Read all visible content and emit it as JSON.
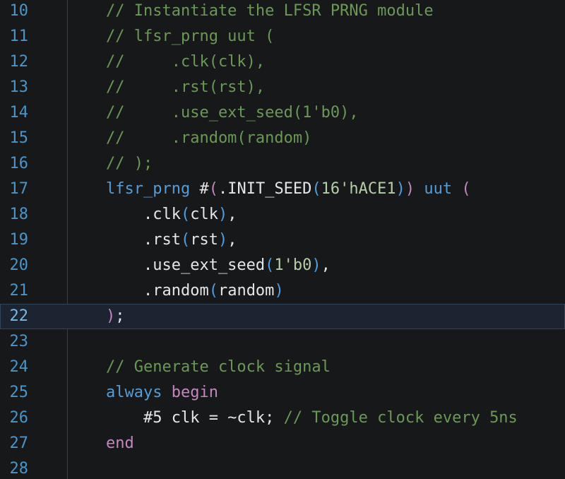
{
  "editor": {
    "colors": {
      "background": "#17181a",
      "line_number": "#4b95c8",
      "comment": "#6a9955",
      "keyword": "#569cd6",
      "control": "#c586c0",
      "number": "#b5cea8",
      "current_line": "#1b2430"
    },
    "current_line_number": "22",
    "lines": [
      {
        "num": "10",
        "tokens": [
          {
            "t": "// Instantiate the LFSR PRNG module",
            "c": "comment"
          }
        ]
      },
      {
        "num": "11",
        "tokens": [
          {
            "t": "// lfsr_prng uut (",
            "c": "comment"
          }
        ]
      },
      {
        "num": "12",
        "tokens": [
          {
            "t": "//     .clk(clk),",
            "c": "comment"
          }
        ]
      },
      {
        "num": "13",
        "tokens": [
          {
            "t": "//     .rst(rst),",
            "c": "comment"
          }
        ]
      },
      {
        "num": "14",
        "tokens": [
          {
            "t": "//     .use_ext_seed(1'b0),",
            "c": "comment"
          }
        ]
      },
      {
        "num": "15",
        "tokens": [
          {
            "t": "//     .random(random)",
            "c": "comment"
          }
        ]
      },
      {
        "num": "16",
        "tokens": [
          {
            "t": "// );",
            "c": "comment"
          }
        ]
      },
      {
        "num": "17",
        "tokens": [
          {
            "t": "lfsr_prng",
            "c": "keyword"
          },
          {
            "t": " #",
            "c": "ident"
          },
          {
            "t": "(",
            "c": "paren1"
          },
          {
            "t": ".INIT_SEED",
            "c": "ident"
          },
          {
            "t": "(",
            "c": "paren2"
          },
          {
            "t": "16'hACE1",
            "c": "number"
          },
          {
            "t": ")",
            "c": "paren2"
          },
          {
            "t": ")",
            "c": "paren1"
          },
          {
            "t": " ",
            "c": "ident"
          },
          {
            "t": "uut",
            "c": "keyword"
          },
          {
            "t": " ",
            "c": "ident"
          },
          {
            "t": "(",
            "c": "paren1"
          }
        ]
      },
      {
        "num": "18",
        "tokens": [
          {
            "t": "    .clk",
            "c": "ident"
          },
          {
            "t": "(",
            "c": "paren2"
          },
          {
            "t": "clk",
            "c": "ident"
          },
          {
            "t": ")",
            "c": "paren2"
          },
          {
            "t": ",",
            "c": "ident"
          }
        ]
      },
      {
        "num": "19",
        "tokens": [
          {
            "t": "    .rst",
            "c": "ident"
          },
          {
            "t": "(",
            "c": "paren2"
          },
          {
            "t": "rst",
            "c": "ident"
          },
          {
            "t": ")",
            "c": "paren2"
          },
          {
            "t": ",",
            "c": "ident"
          }
        ]
      },
      {
        "num": "20",
        "tokens": [
          {
            "t": "    .use_ext_seed",
            "c": "ident"
          },
          {
            "t": "(",
            "c": "paren2"
          },
          {
            "t": "1'b0",
            "c": "number"
          },
          {
            "t": ")",
            "c": "paren2"
          },
          {
            "t": ",",
            "c": "ident"
          }
        ]
      },
      {
        "num": "21",
        "tokens": [
          {
            "t": "    .random",
            "c": "ident"
          },
          {
            "t": "(",
            "c": "paren2"
          },
          {
            "t": "random",
            "c": "ident"
          },
          {
            "t": ")",
            "c": "paren2"
          }
        ]
      },
      {
        "num": "22",
        "tokens": [
          {
            "t": ")",
            "c": "paren1"
          },
          {
            "t": ";",
            "c": "ident"
          }
        ]
      },
      {
        "num": "23",
        "tokens": []
      },
      {
        "num": "24",
        "tokens": [
          {
            "t": "// Generate clock signal",
            "c": "comment"
          }
        ]
      },
      {
        "num": "25",
        "tokens": [
          {
            "t": "always",
            "c": "keyword"
          },
          {
            "t": " ",
            "c": "ident"
          },
          {
            "t": "begin",
            "c": "control"
          }
        ]
      },
      {
        "num": "26",
        "tokens": [
          {
            "t": "    #5 clk = ~clk; ",
            "c": "ident"
          },
          {
            "t": "// Toggle clock every 5ns",
            "c": "comment"
          }
        ]
      },
      {
        "num": "27",
        "tokens": [
          {
            "t": "end",
            "c": "control"
          }
        ]
      },
      {
        "num": "28",
        "tokens": []
      }
    ]
  }
}
